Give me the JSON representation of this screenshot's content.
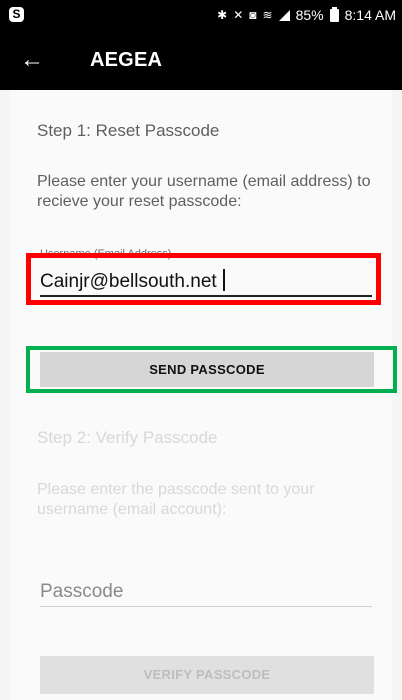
{
  "status_bar": {
    "app_icon": "S",
    "icons": [
      "bluetooth-icon",
      "mute-icon",
      "nfc-icon",
      "wifi-icon",
      "signal-icon",
      "battery-icon"
    ],
    "battery": "85%",
    "time": "8:14 AM"
  },
  "app_bar": {
    "back_icon": "back-arrow-icon",
    "title": "AEGEA"
  },
  "step1": {
    "title": "Step 1: Reset Passcode",
    "description": "Please enter your username (email address) to recieve your reset passcode:",
    "username_label": "Username (Email Address)",
    "username_value": "Cainjr@bellsouth.net",
    "send_button": "SEND PASSCODE"
  },
  "step2": {
    "title": "Step 2: Verify Passcode",
    "description": "Please enter the passcode sent to your username (email account):",
    "passcode_placeholder": "Passcode",
    "verify_button": "VERIFY PASSCODE"
  },
  "highlights": {
    "username_box_color": "#ff0000",
    "send_box_color": "#00b050"
  }
}
